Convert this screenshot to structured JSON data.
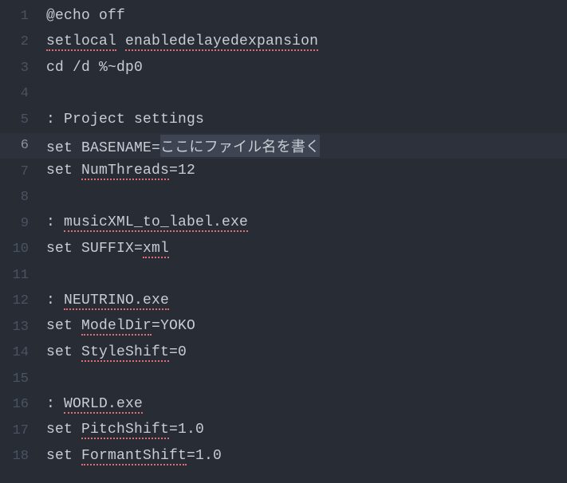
{
  "lines": [
    {
      "n": 1,
      "segments": [
        {
          "t": "@echo off"
        }
      ]
    },
    {
      "n": 2,
      "segments": [
        {
          "t": "setlocal",
          "u": true
        },
        {
          "t": " "
        },
        {
          "t": "enabledelayedexpansion",
          "u": true
        }
      ]
    },
    {
      "n": 3,
      "segments": [
        {
          "t": "cd /d %~dp0"
        }
      ]
    },
    {
      "n": 4,
      "segments": []
    },
    {
      "n": 5,
      "segments": [
        {
          "t": ": Project settings"
        }
      ]
    },
    {
      "n": 6,
      "current": true,
      "segments": [
        {
          "t": "set BASENAME="
        },
        {
          "t": "ここにファイル名を書く",
          "sel": true
        }
      ]
    },
    {
      "n": 7,
      "segments": [
        {
          "t": "set "
        },
        {
          "t": "NumThreads",
          "u": true
        },
        {
          "t": "=12"
        }
      ]
    },
    {
      "n": 8,
      "segments": []
    },
    {
      "n": 9,
      "segments": [
        {
          "t": ": "
        },
        {
          "t": "musicXML_to_label.exe",
          "u": true
        }
      ]
    },
    {
      "n": 10,
      "segments": [
        {
          "t": "set SUFFIX="
        },
        {
          "t": "xml",
          "u": true
        }
      ]
    },
    {
      "n": 11,
      "segments": []
    },
    {
      "n": 12,
      "segments": [
        {
          "t": ": "
        },
        {
          "t": "NEUTRINO.exe",
          "u": true
        }
      ]
    },
    {
      "n": 13,
      "segments": [
        {
          "t": "set "
        },
        {
          "t": "ModelDir",
          "u": true
        },
        {
          "t": "=YOKO"
        }
      ]
    },
    {
      "n": 14,
      "segments": [
        {
          "t": "set "
        },
        {
          "t": "StyleShift",
          "u": true
        },
        {
          "t": "=0"
        }
      ]
    },
    {
      "n": 15,
      "segments": []
    },
    {
      "n": 16,
      "segments": [
        {
          "t": ": "
        },
        {
          "t": "WORLD.exe",
          "u": true
        }
      ]
    },
    {
      "n": 17,
      "segments": [
        {
          "t": "set "
        },
        {
          "t": "PitchShift",
          "u": true
        },
        {
          "t": "=1.0"
        }
      ]
    },
    {
      "n": 18,
      "segments": [
        {
          "t": "set "
        },
        {
          "t": "FormantShift",
          "u": true
        },
        {
          "t": "=1.0"
        }
      ]
    }
  ]
}
